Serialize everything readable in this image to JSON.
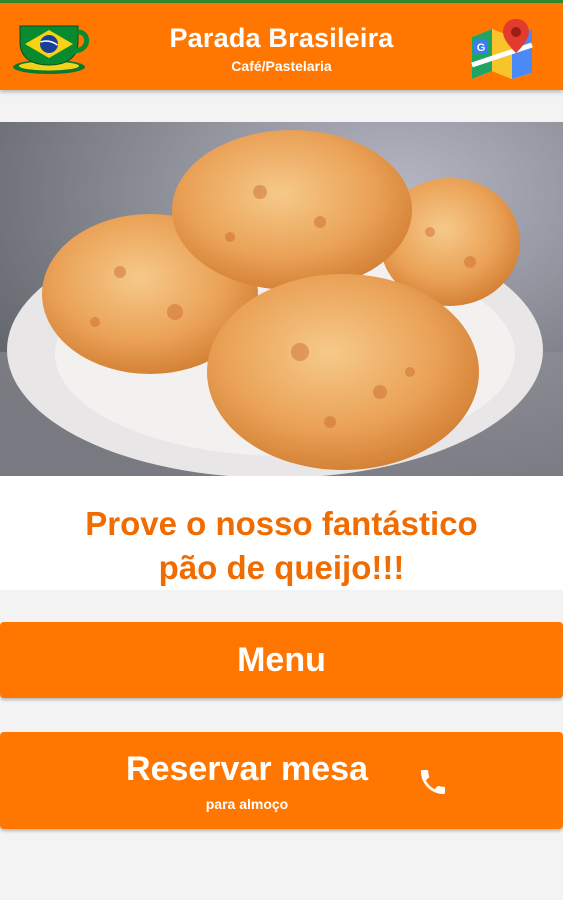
{
  "app_bar": {
    "title": "Parada Brasileira",
    "subtitle": "Café/Pastelaria",
    "logo_icon": "brazil-flag-cup-icon",
    "maps_icon": "google-maps-icon",
    "background_color": "#ff7700",
    "top_line_color": "#2e8b2e"
  },
  "hero": {
    "image": "plate of pão de queijo"
  },
  "promo": {
    "line1": "Prove o nosso fantástico",
    "line2": "pão de queijo!!!",
    "text_color": "#f06c00"
  },
  "buttons": {
    "menu": {
      "label": "Menu"
    },
    "reserve": {
      "label": "Reservar mesa",
      "sublabel": "para almoço",
      "icon": "phone-icon"
    }
  }
}
